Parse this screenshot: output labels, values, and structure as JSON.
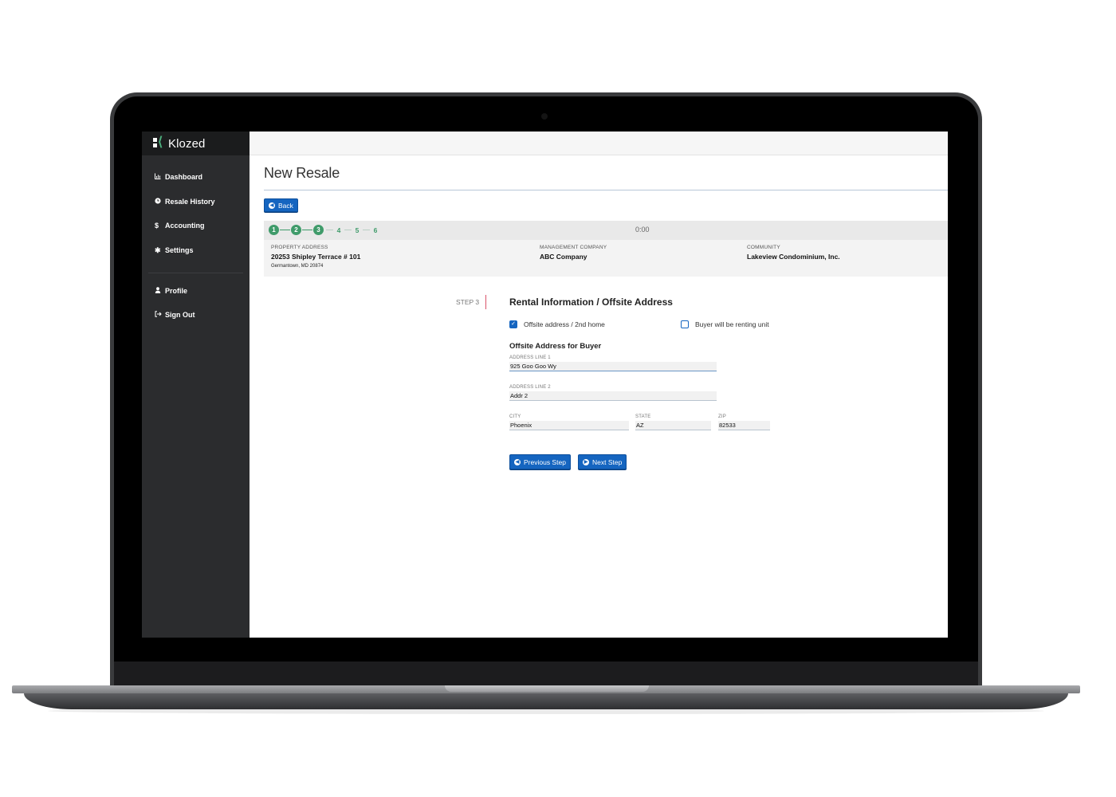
{
  "brand": {
    "name": "Klozed"
  },
  "sidebar": {
    "items": [
      {
        "label": "Dashboard",
        "icon": "chart-icon"
      },
      {
        "label": "Resale History",
        "icon": "clock-icon"
      },
      {
        "label": "Accounting",
        "icon": "dollar-icon"
      },
      {
        "label": "Settings",
        "icon": "gear-icon"
      }
    ],
    "account_items": [
      {
        "label": "Profile",
        "icon": "user-icon"
      },
      {
        "label": "Sign Out",
        "icon": "sign-out-icon"
      }
    ]
  },
  "page": {
    "title": "New Resale",
    "back_label": "Back"
  },
  "progress": {
    "completed_steps": [
      "1",
      "2",
      "3"
    ],
    "pending_steps": [
      "4",
      "5",
      "6"
    ],
    "timer": "0:00"
  },
  "info": {
    "property_label": "PROPERTY ADDRESS",
    "property_value": "20253 Shipley Terrace # 101",
    "property_sub": "Germantown, MD 20874",
    "management_label": "MANAGEMENT COMPANY",
    "management_value": "ABC Company",
    "community_label": "COMMUNITY",
    "community_value": "Lakeview Condominium, Inc."
  },
  "form": {
    "step_label": "STEP 3",
    "title": "Rental Information / Offsite Address",
    "offsite_checkbox": {
      "label": "Offsite address / 2nd home",
      "checked": true
    },
    "renting_checkbox": {
      "label": "Buyer will be renting unit",
      "checked": false
    },
    "subtitle": "Offsite Address for Buyer",
    "address1": {
      "label": "ADDRESS LINE 1",
      "value": "925 Goo Goo Wy"
    },
    "address2": {
      "label": "ADDRESS LINE 2",
      "value": "Addr 2"
    },
    "city": {
      "label": "CITY",
      "value": "Phoenix"
    },
    "state": {
      "label": "STATE",
      "value": "AZ"
    },
    "zip": {
      "label": "ZIP",
      "value": "82533"
    },
    "prev_label": "Previous Step",
    "next_label": "Next Step"
  },
  "colors": {
    "accent": "#1565c0",
    "progress": "#3f9b6a",
    "sidebar": "#2b2c2e",
    "step_marker": "#d9536a"
  }
}
